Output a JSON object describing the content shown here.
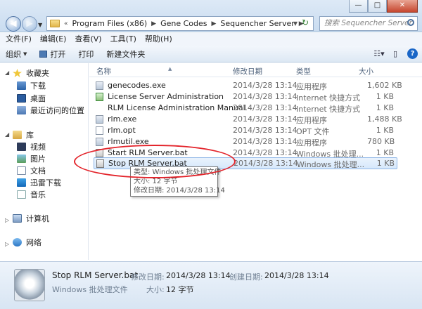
{
  "window": {
    "minimize": "—",
    "maximize": "□",
    "close": "✕"
  },
  "address": {
    "crumbs": [
      "Program Files (x86)",
      "Gene Codes",
      "Sequencher Server"
    ],
    "leading": "«"
  },
  "search": {
    "placeholder": "搜索 Sequencher Server"
  },
  "menu": [
    "文件(F)",
    "编辑(E)",
    "查看(V)",
    "工具(T)",
    "帮助(H)"
  ],
  "toolbar": {
    "organize": "组织",
    "open": "打开",
    "print": "打印",
    "new_folder": "新建文件夹",
    "help": "?"
  },
  "sidebar": {
    "favorites": "收藏夹",
    "downloads": "下载",
    "desktop": "桌面",
    "recent": "最近访问的位置",
    "libraries": "库",
    "videos": "视频",
    "pictures": "图片",
    "documents": "文档",
    "xunlei": "迅雷下载",
    "music": "音乐",
    "computer": "计算机",
    "network": "网络"
  },
  "columns": {
    "name": "名称",
    "date": "修改日期",
    "type": "类型",
    "size": "大小"
  },
  "files": [
    {
      "name": "genecodes.exe",
      "date": "2014/3/28 13:14",
      "type": "应用程序",
      "size": "1,602 KB",
      "icon": "exe-icon"
    },
    {
      "name": "License Server Administration",
      "date": "2014/3/28 13:14",
      "type": "Internet 快捷方式",
      "size": "1 KB",
      "icon": "shortcut-icon"
    },
    {
      "name": "RLM License Administration Manual",
      "date": "2014/3/28 13:14",
      "type": "Internet 快捷方式",
      "size": "1 KB",
      "icon": "none"
    },
    {
      "name": "rlm.exe",
      "date": "2014/3/28 13:14",
      "type": "应用程序",
      "size": "1,488 KB",
      "icon": "exe-icon"
    },
    {
      "name": "rlm.opt",
      "date": "2014/3/28 13:14",
      "type": "OPT 文件",
      "size": "1 KB",
      "icon": "file-icon"
    },
    {
      "name": "rlmutil.exe",
      "date": "2014/3/28 13:14",
      "type": "应用程序",
      "size": "780 KB",
      "icon": "exe-icon"
    },
    {
      "name": "Start RLM Server.bat",
      "date": "2014/3/28 13:14",
      "type": "Windows 批处理...",
      "size": "1 KB",
      "icon": "bat-icon"
    },
    {
      "name": "Stop RLM Server.bat",
      "date": "2014/3/28 13:14",
      "type": "Windows 批处理...",
      "size": "1 KB",
      "icon": "bat-icon",
      "selected": true
    }
  ],
  "tooltip": {
    "type": "类型: Windows 批处理文件",
    "size": "大小: 12 字节",
    "modified": "修改日期: 2014/3/28 13:14"
  },
  "status": {
    "filename": "Stop RLM Server.bat",
    "modified_label": "修改日期:",
    "modified_value": "2014/3/28 13:14",
    "created_label": "创建日期:",
    "created_value": "2014/3/28 13:14",
    "type": "Windows 批处理文件",
    "size_label": "大小:",
    "size_value": "12 字节"
  },
  "colors": {
    "highlight": "#e3242b",
    "selection": "#d6e8fb"
  }
}
